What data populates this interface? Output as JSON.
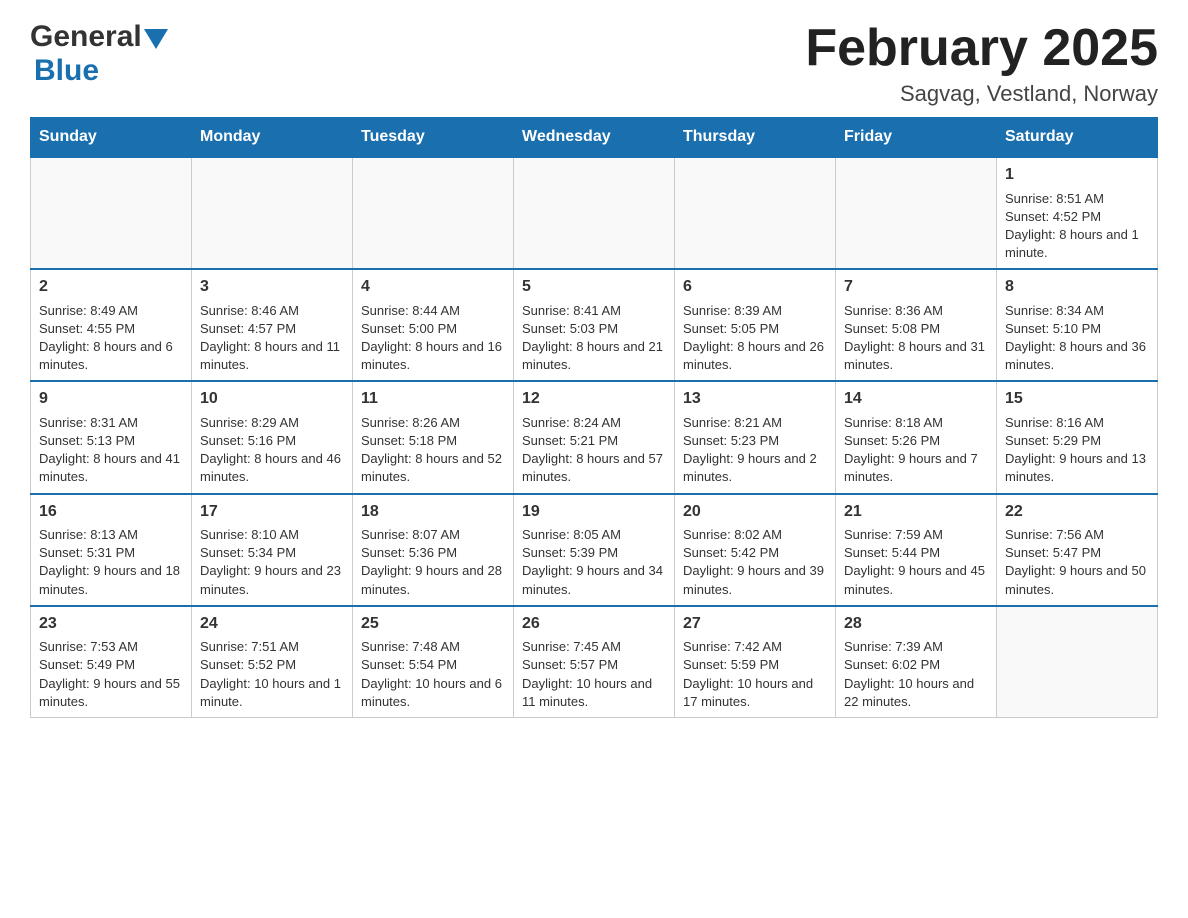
{
  "header": {
    "logo_general": "General",
    "logo_blue": "Blue",
    "month_title": "February 2025",
    "location": "Sagvag, Vestland, Norway"
  },
  "weekdays": [
    "Sunday",
    "Monday",
    "Tuesday",
    "Wednesday",
    "Thursday",
    "Friday",
    "Saturday"
  ],
  "weeks": [
    [
      {
        "day": "",
        "info": ""
      },
      {
        "day": "",
        "info": ""
      },
      {
        "day": "",
        "info": ""
      },
      {
        "day": "",
        "info": ""
      },
      {
        "day": "",
        "info": ""
      },
      {
        "day": "",
        "info": ""
      },
      {
        "day": "1",
        "info": "Sunrise: 8:51 AM\nSunset: 4:52 PM\nDaylight: 8 hours and 1 minute."
      }
    ],
    [
      {
        "day": "2",
        "info": "Sunrise: 8:49 AM\nSunset: 4:55 PM\nDaylight: 8 hours and 6 minutes."
      },
      {
        "day": "3",
        "info": "Sunrise: 8:46 AM\nSunset: 4:57 PM\nDaylight: 8 hours and 11 minutes."
      },
      {
        "day": "4",
        "info": "Sunrise: 8:44 AM\nSunset: 5:00 PM\nDaylight: 8 hours and 16 minutes."
      },
      {
        "day": "5",
        "info": "Sunrise: 8:41 AM\nSunset: 5:03 PM\nDaylight: 8 hours and 21 minutes."
      },
      {
        "day": "6",
        "info": "Sunrise: 8:39 AM\nSunset: 5:05 PM\nDaylight: 8 hours and 26 minutes."
      },
      {
        "day": "7",
        "info": "Sunrise: 8:36 AM\nSunset: 5:08 PM\nDaylight: 8 hours and 31 minutes."
      },
      {
        "day": "8",
        "info": "Sunrise: 8:34 AM\nSunset: 5:10 PM\nDaylight: 8 hours and 36 minutes."
      }
    ],
    [
      {
        "day": "9",
        "info": "Sunrise: 8:31 AM\nSunset: 5:13 PM\nDaylight: 8 hours and 41 minutes."
      },
      {
        "day": "10",
        "info": "Sunrise: 8:29 AM\nSunset: 5:16 PM\nDaylight: 8 hours and 46 minutes."
      },
      {
        "day": "11",
        "info": "Sunrise: 8:26 AM\nSunset: 5:18 PM\nDaylight: 8 hours and 52 minutes."
      },
      {
        "day": "12",
        "info": "Sunrise: 8:24 AM\nSunset: 5:21 PM\nDaylight: 8 hours and 57 minutes."
      },
      {
        "day": "13",
        "info": "Sunrise: 8:21 AM\nSunset: 5:23 PM\nDaylight: 9 hours and 2 minutes."
      },
      {
        "day": "14",
        "info": "Sunrise: 8:18 AM\nSunset: 5:26 PM\nDaylight: 9 hours and 7 minutes."
      },
      {
        "day": "15",
        "info": "Sunrise: 8:16 AM\nSunset: 5:29 PM\nDaylight: 9 hours and 13 minutes."
      }
    ],
    [
      {
        "day": "16",
        "info": "Sunrise: 8:13 AM\nSunset: 5:31 PM\nDaylight: 9 hours and 18 minutes."
      },
      {
        "day": "17",
        "info": "Sunrise: 8:10 AM\nSunset: 5:34 PM\nDaylight: 9 hours and 23 minutes."
      },
      {
        "day": "18",
        "info": "Sunrise: 8:07 AM\nSunset: 5:36 PM\nDaylight: 9 hours and 28 minutes."
      },
      {
        "day": "19",
        "info": "Sunrise: 8:05 AM\nSunset: 5:39 PM\nDaylight: 9 hours and 34 minutes."
      },
      {
        "day": "20",
        "info": "Sunrise: 8:02 AM\nSunset: 5:42 PM\nDaylight: 9 hours and 39 minutes."
      },
      {
        "day": "21",
        "info": "Sunrise: 7:59 AM\nSunset: 5:44 PM\nDaylight: 9 hours and 45 minutes."
      },
      {
        "day": "22",
        "info": "Sunrise: 7:56 AM\nSunset: 5:47 PM\nDaylight: 9 hours and 50 minutes."
      }
    ],
    [
      {
        "day": "23",
        "info": "Sunrise: 7:53 AM\nSunset: 5:49 PM\nDaylight: 9 hours and 55 minutes."
      },
      {
        "day": "24",
        "info": "Sunrise: 7:51 AM\nSunset: 5:52 PM\nDaylight: 10 hours and 1 minute."
      },
      {
        "day": "25",
        "info": "Sunrise: 7:48 AM\nSunset: 5:54 PM\nDaylight: 10 hours and 6 minutes."
      },
      {
        "day": "26",
        "info": "Sunrise: 7:45 AM\nSunset: 5:57 PM\nDaylight: 10 hours and 11 minutes."
      },
      {
        "day": "27",
        "info": "Sunrise: 7:42 AM\nSunset: 5:59 PM\nDaylight: 10 hours and 17 minutes."
      },
      {
        "day": "28",
        "info": "Sunrise: 7:39 AM\nSunset: 6:02 PM\nDaylight: 10 hours and 22 minutes."
      },
      {
        "day": "",
        "info": ""
      }
    ]
  ]
}
